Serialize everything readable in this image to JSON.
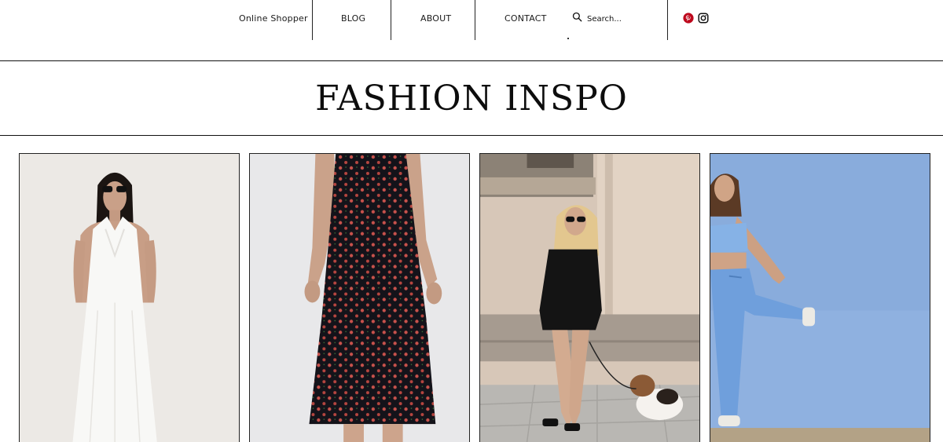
{
  "nav": {
    "site_name": "Online Shopper",
    "links": [
      "BLOG",
      "ABOUT",
      "CONTACT"
    ],
    "search_placeholder": "Search..."
  },
  "social": {
    "pinterest": "pinterest-icon",
    "instagram": "instagram-icon",
    "pinterest_color": "#bd081c"
  },
  "page": {
    "title": "FASHION INSPO"
  },
  "gallery": {
    "items": [
      "white-halter-maxi-dress-image",
      "black-floral-slip-dress-image",
      "black-mini-dress-street-image",
      "blue-activewear-set-image"
    ]
  }
}
